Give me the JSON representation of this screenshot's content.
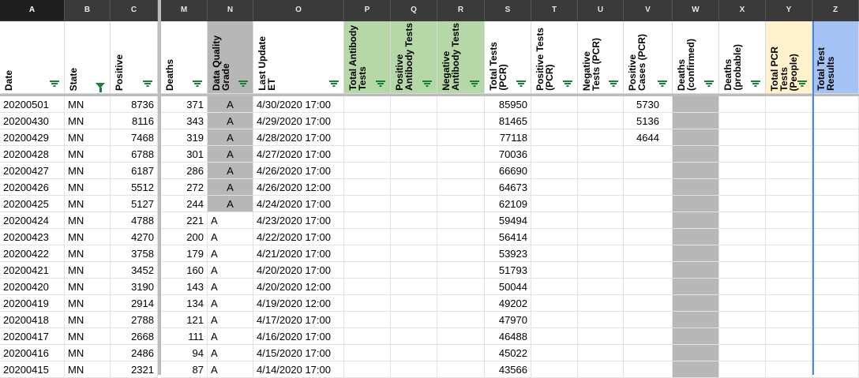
{
  "colors": {
    "green_header": "#b6d7a8",
    "yellow_header": "#fff2cc",
    "blue_header": "#a4c2f4",
    "gray_cell": "#b7b7b7",
    "filter_icon": "#188038",
    "selected_column": "#1f1f1f"
  },
  "column_letters": [
    "A",
    "B",
    "C",
    "M",
    "N",
    "O",
    "P",
    "Q",
    "R",
    "S",
    "T",
    "U",
    "V",
    "W",
    "X",
    "Y",
    "Z"
  ],
  "headers": {
    "date": "Date",
    "state": "State",
    "positive": "Positive",
    "deaths": "Deaths",
    "dqg": "Data Quality\nGrade",
    "last_update": "Last Update\nET",
    "total_antibody": "Total Antibody\nTests",
    "positive_antibody": "Positive\nAntibody Tests",
    "negative_antibody": "Negative\nAntibody Tests",
    "total_pcr": "Total Tests\n(PCR)",
    "positive_tests_pcr": "Positive Tests\n(PCR)",
    "negative_tests_pcr": "Negative\nTests (PCR)",
    "positive_cases_pcr": "Positive\nCases (PCR)",
    "deaths_confirmed": "Deaths\n(confirmed)",
    "deaths_probable": "Deaths\n(probable)",
    "total_pcr_people": "Total PCR\nTests\n(People)",
    "total_test_results": "Total Test\nResults"
  },
  "rows": [
    {
      "date": "20200501",
      "state": "MN",
      "positive": "8736",
      "deaths": "371",
      "grade": "A",
      "updated": "4/30/2020 17:00",
      "total_pcr": "85950",
      "positive_cases": "5730"
    },
    {
      "date": "20200430",
      "state": "MN",
      "positive": "8116",
      "deaths": "343",
      "grade": "A",
      "updated": "4/29/2020 17:00",
      "total_pcr": "81465",
      "positive_cases": "5136"
    },
    {
      "date": "20200429",
      "state": "MN",
      "positive": "7468",
      "deaths": "319",
      "grade": "A",
      "updated": "4/28/2020 17:00",
      "total_pcr": "77118",
      "positive_cases": "4644"
    },
    {
      "date": "20200428",
      "state": "MN",
      "positive": "6788",
      "deaths": "301",
      "grade": "A",
      "updated": "4/27/2020 17:00",
      "total_pcr": "70036",
      "positive_cases": ""
    },
    {
      "date": "20200427",
      "state": "MN",
      "positive": "6187",
      "deaths": "286",
      "grade": "A",
      "updated": "4/26/2020 17:00",
      "total_pcr": "66690",
      "positive_cases": ""
    },
    {
      "date": "20200426",
      "state": "MN",
      "positive": "5512",
      "deaths": "272",
      "grade": "A",
      "updated": "4/26/2020 12:00",
      "total_pcr": "64673",
      "positive_cases": ""
    },
    {
      "date": "20200425",
      "state": "MN",
      "positive": "5127",
      "deaths": "244",
      "grade": "A",
      "updated": "4/24/2020 17:00",
      "total_pcr": "62109",
      "positive_cases": ""
    },
    {
      "date": "20200424",
      "state": "MN",
      "positive": "4788",
      "deaths": "221",
      "grade": "A",
      "updated": "4/23/2020 17:00",
      "total_pcr": "59494",
      "positive_cases": ""
    },
    {
      "date": "20200423",
      "state": "MN",
      "positive": "4270",
      "deaths": "200",
      "grade": "A",
      "updated": "4/22/2020 17:00",
      "total_pcr": "56414",
      "positive_cases": ""
    },
    {
      "date": "20200422",
      "state": "MN",
      "positive": "3758",
      "deaths": "179",
      "grade": "A",
      "updated": "4/21/2020 17:00",
      "total_pcr": "53923",
      "positive_cases": ""
    },
    {
      "date": "20200421",
      "state": "MN",
      "positive": "3452",
      "deaths": "160",
      "grade": "A",
      "updated": "4/20/2020 17:00",
      "total_pcr": "51793",
      "positive_cases": ""
    },
    {
      "date": "20200420",
      "state": "MN",
      "positive": "3190",
      "deaths": "143",
      "grade": "A",
      "updated": "4/20/2020 12:00",
      "total_pcr": "50044",
      "positive_cases": ""
    },
    {
      "date": "20200419",
      "state": "MN",
      "positive": "2914",
      "deaths": "134",
      "grade": "A",
      "updated": "4/19/2020 12:00",
      "total_pcr": "49202",
      "positive_cases": ""
    },
    {
      "date": "20200418",
      "state": "MN",
      "positive": "2788",
      "deaths": "121",
      "grade": "A",
      "updated": "4/17/2020 17:00",
      "total_pcr": "47970",
      "positive_cases": ""
    },
    {
      "date": "20200417",
      "state": "MN",
      "positive": "2668",
      "deaths": "111",
      "grade": "A",
      "updated": "4/16/2020 17:00",
      "total_pcr": "46488",
      "positive_cases": ""
    },
    {
      "date": "20200416",
      "state": "MN",
      "positive": "2486",
      "deaths": "94",
      "grade": "A",
      "updated": "4/15/2020 17:00",
      "total_pcr": "45022",
      "positive_cases": ""
    },
    {
      "date": "20200415",
      "state": "MN",
      "positive": "2321",
      "deaths": "87",
      "grade": "A",
      "updated": "4/14/2020 17:00",
      "total_pcr": "43566",
      "positive_cases": ""
    }
  ]
}
